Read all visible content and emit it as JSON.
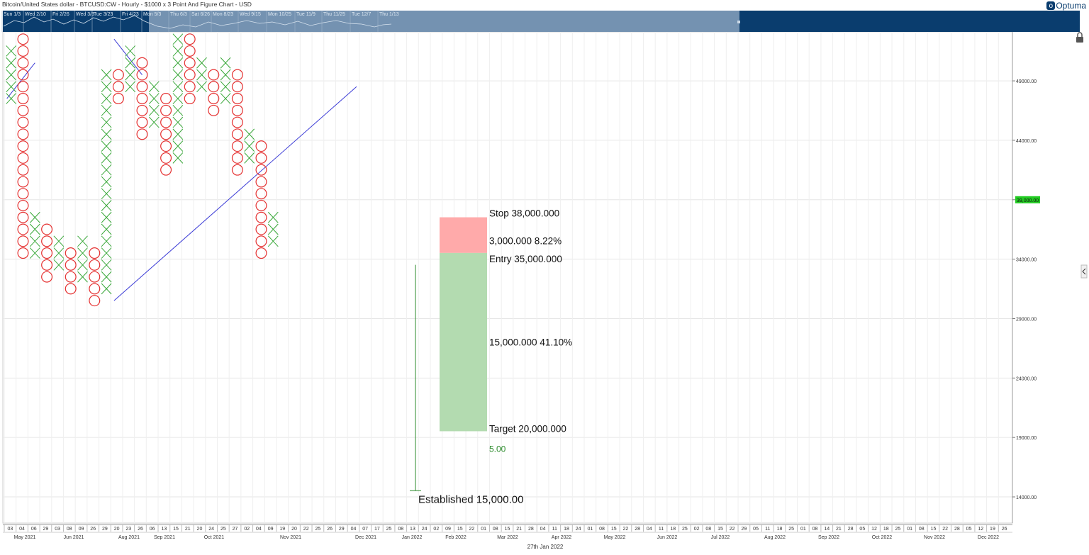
{
  "header": {
    "title": "Bitcoin/United States dollar - BTCUSD:CW - Hourly - $1000 x 3 Point And Figure Chart - USD",
    "logo_text": "Optuma"
  },
  "navigator": {
    "labels": [
      "Sun 1/3",
      "Wed 2/10",
      "Fri 2/26",
      "Wed 3/3",
      "Tue 3/23",
      "Fri 4/23",
      "Mon 5/3",
      "Thu 6/3",
      "Sat 6/26",
      "Mon 8/23",
      "Wed 9/15",
      "Mon 10/25",
      "Tue 11/9",
      "Thu 11/25",
      "Tue 12/7",
      "Thu 1/13"
    ]
  },
  "colors": {
    "x_color": "#3aa83a",
    "o_color": "#e53030",
    "trendline": "#3b3bd6",
    "stop_zone": "#ffaaaa",
    "target_zone": "#b3dbb0",
    "current_price_bg": "#22cc22",
    "navigator_bg": "#0a3d6e",
    "established_line": "#2a8a2a"
  },
  "chart_data": {
    "type": "point-and-figure",
    "title": "Bitcoin/United States dollar - BTCUSD:CW - Hourly - $1000 x 3 Point And Figure Chart - USD",
    "box_size": 1000,
    "reversal": 3,
    "ylim": [
      13000,
      53000
    ],
    "y_ticks": [
      "49000.00",
      "44000.00",
      "39000.00",
      "34000.00",
      "29000.00",
      "24000.00",
      "19000.00",
      "14000.00"
    ],
    "current_price": "39,000.00",
    "x_day_labels": [
      "03",
      "04",
      "06",
      "29",
      "03",
      "08",
      "09",
      "26",
      "29",
      "20",
      "23",
      "26",
      "06",
      "13",
      "15",
      "21",
      "20",
      "24",
      "25",
      "27",
      "02",
      "04",
      "09",
      "19",
      "20",
      "22",
      "25",
      "26",
      "29",
      "04",
      "07",
      "17",
      "25",
      "08",
      "13",
      "24",
      "02",
      "09",
      "15",
      "22",
      "01",
      "08",
      "15",
      "21",
      "28",
      "04",
      "11",
      "18",
      "24",
      "01",
      "08",
      "15",
      "22",
      "28",
      "04",
      "11",
      "18",
      "25",
      "02",
      "08",
      "15",
      "22",
      "29",
      "05",
      "11",
      "18",
      "25",
      "01",
      "08",
      "14",
      "21",
      "28",
      "05",
      "12",
      "18",
      "25",
      "01",
      "08",
      "15",
      "22",
      "28",
      "05",
      "12",
      "19",
      "26"
    ],
    "x_month_labels": [
      "May 2021",
      "Jun 2021",
      "Aug 2021",
      "Sep 2021",
      "Oct 2021",
      "Nov 2021",
      "Dec 2021",
      "Jan 2022",
      "Feb 2022",
      "Mar 2022",
      "Apr 2022",
      "May 2022",
      "Jun 2022",
      "Jul 2022",
      "Aug 2022",
      "Sep 2022",
      "Oct 2022",
      "Nov 2022",
      "Dec 2022"
    ],
    "cursor_date": "27th Jan 2022",
    "columns": [
      {
        "type": "X",
        "low": 48000,
        "high": 52000
      },
      {
        "type": "O",
        "low": 35000,
        "high": 53000
      },
      {
        "type": "X",
        "low": 35000,
        "high": 38000
      },
      {
        "type": "O",
        "low": 33000,
        "high": 37000
      },
      {
        "type": "X",
        "low": 34000,
        "high": 36000
      },
      {
        "type": "O",
        "low": 32000,
        "high": 35000
      },
      {
        "type": "X",
        "low": 33000,
        "high": 36000
      },
      {
        "type": "O",
        "low": 31000,
        "high": 35000
      },
      {
        "type": "X",
        "low": 32000,
        "high": 50000
      },
      {
        "type": "O",
        "low": 48000,
        "high": 50000
      },
      {
        "type": "X",
        "low": 49000,
        "high": 52000
      },
      {
        "type": "O",
        "low": 45000,
        "high": 51000
      },
      {
        "type": "X",
        "low": 46000,
        "high": 49000
      },
      {
        "type": "O",
        "low": 42000,
        "high": 48000
      },
      {
        "type": "X",
        "low": 43000,
        "high": 53000
      },
      {
        "type": "O",
        "low": 48000,
        "high": 53000
      },
      {
        "type": "X",
        "low": 49000,
        "high": 51000
      },
      {
        "type": "O",
        "low": 47000,
        "high": 50000
      },
      {
        "type": "X",
        "low": 48000,
        "high": 51000
      },
      {
        "type": "O",
        "low": 42000,
        "high": 50000
      },
      {
        "type": "X",
        "low": 43000,
        "high": 45000
      },
      {
        "type": "O",
        "low": 35000,
        "high": 44000
      },
      {
        "type": "X",
        "low": 36000,
        "high": 38000
      }
    ],
    "trendlines": [
      {
        "type": "support",
        "from": [
          0,
          48000
        ],
        "to": [
          2,
          51000
        ]
      },
      {
        "type": "resistance",
        "from": [
          9,
          53000
        ],
        "to": [
          11,
          50000
        ]
      },
      {
        "type": "support",
        "from": [
          9,
          31000
        ],
        "to": [
          29,
          49000
        ]
      }
    ],
    "trade": {
      "stop_label": "Stop",
      "stop_price": "38,000.000",
      "risk_amount": "3,000.000",
      "risk_pct": "8.22%",
      "entry_label": "Entry",
      "entry_price": "35,000.000",
      "reward_amount": "15,000.000",
      "reward_pct": "41.10%",
      "target_label": "Target",
      "target_price": "20,000.000",
      "ratio": "5.00",
      "stop": 38000,
      "entry": 35000,
      "target": 20000
    },
    "established": {
      "text": "Established 15,000.00",
      "price": 15000,
      "from_price": 34000
    }
  }
}
